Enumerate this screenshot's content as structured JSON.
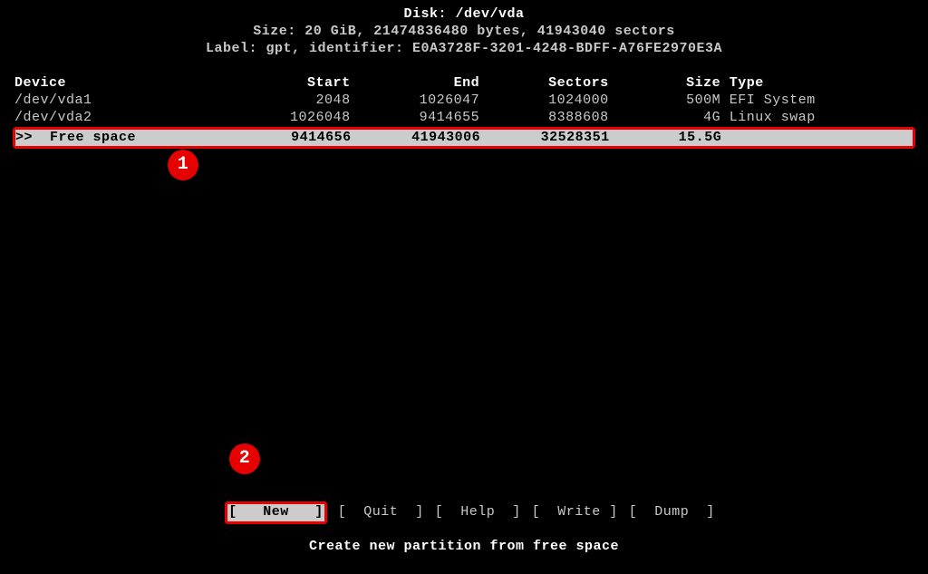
{
  "header": {
    "title": "Disk: /dev/vda",
    "size_line": "Size: 20 GiB, 21474836480 bytes, 41943040 sectors",
    "label_line": "Label: gpt, identifier: E0A3728F-3201-4248-BDFF-A76FE2970E3A"
  },
  "columns": {
    "device": "Device",
    "start": "Start",
    "end": "End",
    "sectors": "Sectors",
    "size": "Size",
    "type": "Type"
  },
  "partitions": [
    {
      "device": "/dev/vda1",
      "start": "2048",
      "end": "1026047",
      "sectors": "1024000",
      "size": "500M",
      "type": "EFI System"
    },
    {
      "device": "/dev/vda2",
      "start": "1026048",
      "end": "9414655",
      "sectors": "8388608",
      "size": "4G",
      "type": "Linux swap"
    }
  ],
  "selected": {
    "indicator": ">>",
    "device": "Free space",
    "start": "9414656",
    "end": "41943006",
    "sectors": "32528351",
    "size": "15.5G",
    "type": ""
  },
  "callouts": {
    "one": "1",
    "two": "2"
  },
  "actions": {
    "new": "[   New   ]",
    "quit": "[  Quit  ]",
    "help": "[  Help  ]",
    "write": "[  Write ]",
    "dump": "[  Dump  ]"
  },
  "hint": "Create new partition from free space"
}
